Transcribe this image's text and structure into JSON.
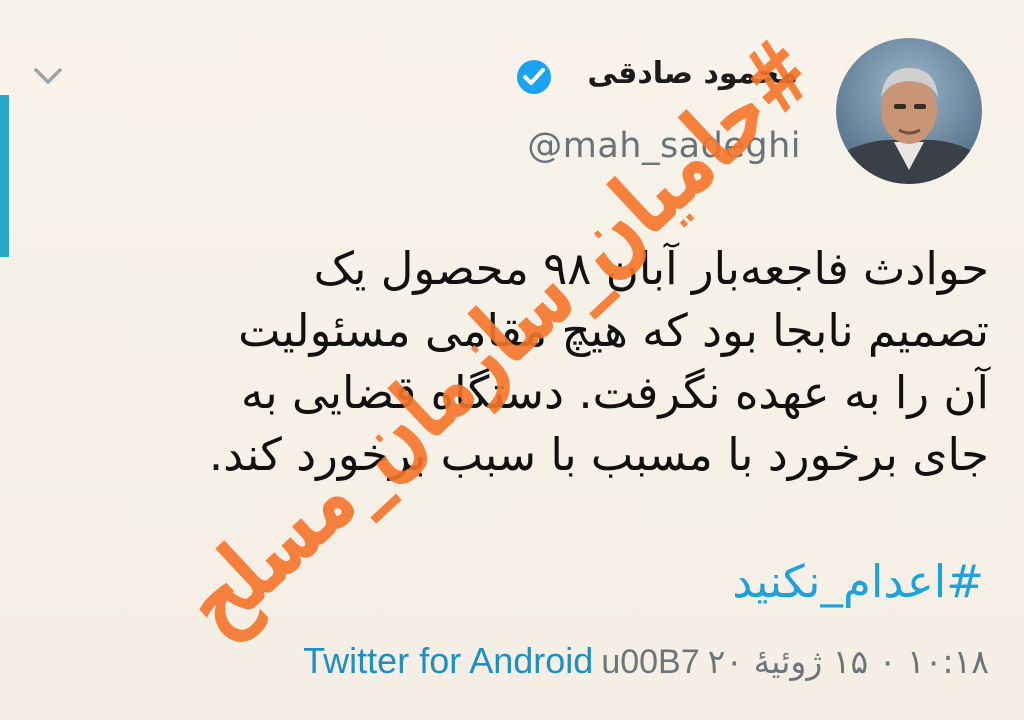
{
  "tweet": {
    "display_name": "محمود صادقی",
    "handle": "@mah_sadeghi",
    "verified": true,
    "body_lines": [
      "حوادث فاجعه‌بار آبان ۹۸ محصول یک",
      "تصمیم نابجا بود که هیچ مقامی مسئولیت",
      "آن را به عهده نگرفت. دستگاه قضایی به",
      "جای برخورد با مسبب با سبب برخورد کند."
    ],
    "hashtag": "#اعدام_نکنید",
    "time_label": "۱۰:۱۸ ۰ ۱۵ ژوئیهٔ ۲۰",
    "dot_text": "u00B7",
    "source_label": "Twitter for Android"
  },
  "overlay": {
    "watermark_text": "#حامیان_سازمان_مسلح",
    "watermark_color": "#f5752b"
  },
  "colors": {
    "background": "#f6f1e8",
    "accent": "#27a6c8",
    "hashtag": "#1ea2da",
    "verified": "#1da1f2"
  },
  "icons": {
    "menu": "chevron-down-icon",
    "verified": "verified-badge-icon"
  }
}
